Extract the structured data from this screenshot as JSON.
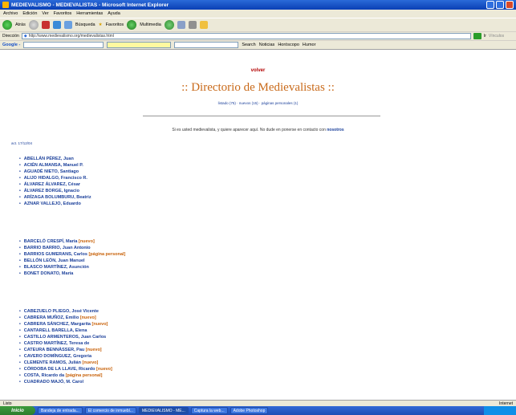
{
  "window": {
    "title": "MEDIEVALISMO - MEDIEVALISTAS - Microsoft Internet Explorer"
  },
  "menu": [
    "Archivo",
    "Edición",
    "Ver",
    "Favoritos",
    "Herramientas",
    "Ayuda"
  ],
  "toolbar": {
    "back": "Atrás",
    "search": "Búsqueda",
    "favorites": "Favoritos",
    "multimedia": "Multimedia"
  },
  "address": {
    "label": "Dirección",
    "url": "http://www.medievalismo.org/medievalistas.html",
    "go": "Ir",
    "links": "Vínculos"
  },
  "googlebar": {
    "logo": "Google -",
    "search": "Search",
    "items": [
      "Noticias",
      "Horóscopo",
      "Humor"
    ]
  },
  "page": {
    "volver": "volver",
    "heading": ":: Directorio de Medievalistas ::",
    "subnav": "listado (75) · nuevos (15) · páginas personales (1)",
    "contact_text": "Si es usted medievalista, y quiere aparecer aquí. No dude en ponerse en contacto con",
    "contact_link": "nosotros",
    "updated": "act. 17/12/04",
    "group_a": [
      {
        "name": "ABELLÁN PÉREZ, Juan",
        "tag": ""
      },
      {
        "name": "ACIÉN ALMANSA, Manuel P.",
        "tag": ""
      },
      {
        "name": "AGUADÉ NIETO, Santiago",
        "tag": ""
      },
      {
        "name": "ALIJO HIDALGO, Francisco R.",
        "tag": ""
      },
      {
        "name": "ÁLVAREZ ÁLVAREZ, César",
        "tag": ""
      },
      {
        "name": "ÁLVAREZ BORGE, Ignacio",
        "tag": ""
      },
      {
        "name": "ARÍZAGA BOLUMBURU, Beatriz",
        "tag": ""
      },
      {
        "name": "AZNAR VALLEJO, Eduardo",
        "tag": ""
      }
    ],
    "group_b": [
      {
        "name": "BARCELÓ CRESPÍ, María",
        "tag": "[nuevo]"
      },
      {
        "name": "BARRIO BARRIO, Juan Antonio",
        "tag": ""
      },
      {
        "name": "BARRIOS GUMERANS, Carlos",
        "tag": "[página personal]"
      },
      {
        "name": "BELLÓN LEÓN, Juan Manuel",
        "tag": ""
      },
      {
        "name": "BLASCO MARTÍNEZ, Asunción",
        "tag": ""
      },
      {
        "name": "BONET DONATO, María",
        "tag": ""
      }
    ],
    "group_c": [
      {
        "name": "CABEZUELO PLIEGO, José Vicente",
        "tag": ""
      },
      {
        "name": "CABRERA MUÑOZ, Emilio",
        "tag": "[nuevo]"
      },
      {
        "name": "CABRERA SÁNCHEZ, Margarita",
        "tag": "[nuevo]"
      },
      {
        "name": "CANTARELL BARELLA, Elena",
        "tag": ""
      },
      {
        "name": "CASTILLO ARMENTEROS, Juan Carlos",
        "tag": ""
      },
      {
        "name": "CASTRO MARTÍNEZ, Teresa de",
        "tag": ""
      },
      {
        "name": "CATEURA BENNÀSSER, Pau",
        "tag": "[nuevo]"
      },
      {
        "name": "CAVERO DOMÍNGUEZ, Gregoria",
        "tag": ""
      },
      {
        "name": "CLEMENTE RAMOS, Julián",
        "tag": "[nuevo]"
      },
      {
        "name": "CÓRDOBA DE LA LLAVE, Ricardo",
        "tag": "[nuevo]"
      },
      {
        "name": "COSTA, Ricardo da",
        "tag": "[página personal]"
      },
      {
        "name": "CUADRADO MAJÓ, M. Carol",
        "tag": ""
      }
    ]
  },
  "status": {
    "left": "Listo",
    "right": "Internet"
  },
  "taskbar": {
    "start": "Inicio",
    "items": [
      "Bandeja de entrada...",
      "El comercio de inmuebl...",
      "MEDIEVALISMO - ME...",
      "Captura la web...",
      "Adobe Photoshop"
    ]
  }
}
